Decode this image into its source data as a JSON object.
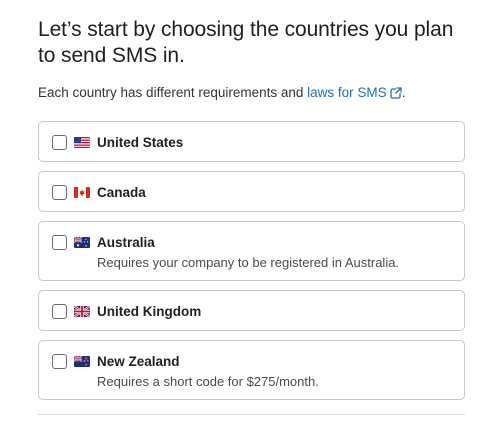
{
  "header": {
    "title": "Let’s start by choosing the countries you plan to send SMS in.",
    "subtitle_prefix": "Each country has different requirements and ",
    "subtitle_link": "laws for SMS",
    "subtitle_suffix": ".",
    "link_icon": "external-link-icon"
  },
  "colors": {
    "link": "#1f6fb5",
    "border": "#c8c8cc"
  },
  "countries": [
    {
      "name": "United States",
      "flag": "us-flag",
      "checked": false,
      "description": ""
    },
    {
      "name": "Canada",
      "flag": "canada-flag",
      "checked": false,
      "description": ""
    },
    {
      "name": "Australia",
      "flag": "australia-flag",
      "checked": false,
      "description": "Requires your company to be registered in Australia."
    },
    {
      "name": "United Kingdom",
      "flag": "uk-flag",
      "checked": false,
      "description": ""
    },
    {
      "name": "New Zealand",
      "flag": "new-zealand-flag",
      "checked": false,
      "description": "Requires a short code for $275/month."
    }
  ]
}
